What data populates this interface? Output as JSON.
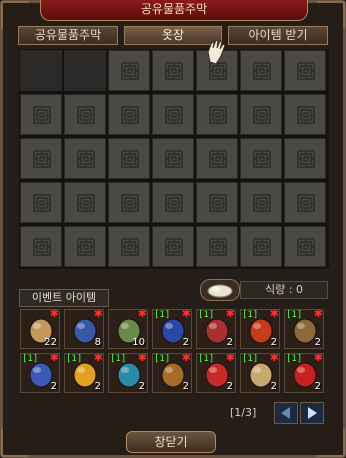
{
  "window": {
    "title": "공유물품주막"
  },
  "tabs": [
    {
      "label": "공유물품주막",
      "active": false
    },
    {
      "label": "옷장",
      "active": true
    },
    {
      "label": "아이템 받기",
      "active": false
    }
  ],
  "storage": {
    "rows": 5,
    "cols": 7,
    "empty_slots": [
      0,
      1
    ]
  },
  "event_section": {
    "label": "이벤트 아이템",
    "food_label": "식량 : 0"
  },
  "event_items": [
    {
      "name": "map-scroll-item",
      "count": "22",
      "level": "",
      "color": "#c49a5a"
    },
    {
      "name": "pouch-item",
      "count": "8",
      "level": "",
      "color": "#3a58a8"
    },
    {
      "name": "green-scroll-item",
      "count": "10",
      "level": "",
      "color": "#6a8a4a"
    },
    {
      "name": "blue-orb-item",
      "count": "2",
      "level": "[1]",
      "color": "#2a48a8"
    },
    {
      "name": "red-orb-item",
      "count": "2",
      "level": "[1]",
      "color": "#a83030"
    },
    {
      "name": "red-talisman-item",
      "count": "2",
      "level": "[1]",
      "color": "#c83a1a"
    },
    {
      "name": "chest-item",
      "count": "2",
      "level": "[1]",
      "color": "#8a6a3a"
    },
    {
      "name": "blue-creature-item",
      "count": "2",
      "level": "[1]",
      "color": "#3a5ab8"
    },
    {
      "name": "rainbow-feather-item",
      "count": "2",
      "level": "[1]",
      "color": "#e0a020"
    },
    {
      "name": "teal-feather-item",
      "count": "2",
      "level": "[1]",
      "color": "#2a8aa8"
    },
    {
      "name": "treasure-pile-item",
      "count": "2",
      "level": "[1]",
      "color": "#a86a2a"
    },
    {
      "name": "bead-set-item",
      "count": "2",
      "level": "[1]",
      "color": "#c82a2a"
    },
    {
      "name": "parchment-item",
      "count": "2",
      "level": "[1]",
      "color": "#c8a870"
    },
    {
      "name": "red-charm-item",
      "count": "2",
      "level": "[1]",
      "color": "#c82020"
    }
  ],
  "pagination": {
    "text": "[1/3]"
  },
  "footer": {
    "close_label": "창닫기"
  }
}
